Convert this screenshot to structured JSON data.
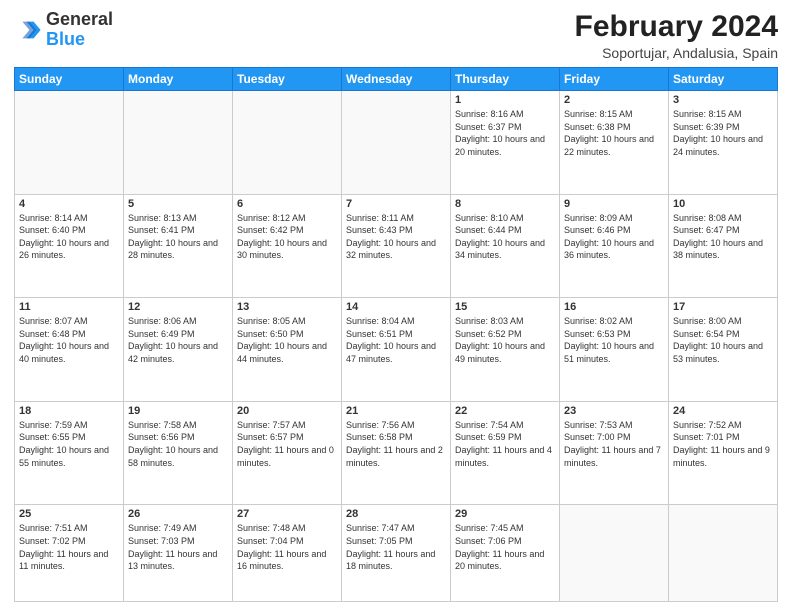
{
  "logo": {
    "line1": "General",
    "line2": "Blue"
  },
  "title": "February 2024",
  "subtitle": "Soportujar, Andalusia, Spain",
  "days_of_week": [
    "Sunday",
    "Monday",
    "Tuesday",
    "Wednesday",
    "Thursday",
    "Friday",
    "Saturday"
  ],
  "weeks": [
    [
      {
        "day": "",
        "info": ""
      },
      {
        "day": "",
        "info": ""
      },
      {
        "day": "",
        "info": ""
      },
      {
        "day": "",
        "info": ""
      },
      {
        "day": "1",
        "info": "Sunrise: 8:16 AM\nSunset: 6:37 PM\nDaylight: 10 hours and 20 minutes."
      },
      {
        "day": "2",
        "info": "Sunrise: 8:15 AM\nSunset: 6:38 PM\nDaylight: 10 hours and 22 minutes."
      },
      {
        "day": "3",
        "info": "Sunrise: 8:15 AM\nSunset: 6:39 PM\nDaylight: 10 hours and 24 minutes."
      }
    ],
    [
      {
        "day": "4",
        "info": "Sunrise: 8:14 AM\nSunset: 6:40 PM\nDaylight: 10 hours and 26 minutes."
      },
      {
        "day": "5",
        "info": "Sunrise: 8:13 AM\nSunset: 6:41 PM\nDaylight: 10 hours and 28 minutes."
      },
      {
        "day": "6",
        "info": "Sunrise: 8:12 AM\nSunset: 6:42 PM\nDaylight: 10 hours and 30 minutes."
      },
      {
        "day": "7",
        "info": "Sunrise: 8:11 AM\nSunset: 6:43 PM\nDaylight: 10 hours and 32 minutes."
      },
      {
        "day": "8",
        "info": "Sunrise: 8:10 AM\nSunset: 6:44 PM\nDaylight: 10 hours and 34 minutes."
      },
      {
        "day": "9",
        "info": "Sunrise: 8:09 AM\nSunset: 6:46 PM\nDaylight: 10 hours and 36 minutes."
      },
      {
        "day": "10",
        "info": "Sunrise: 8:08 AM\nSunset: 6:47 PM\nDaylight: 10 hours and 38 minutes."
      }
    ],
    [
      {
        "day": "11",
        "info": "Sunrise: 8:07 AM\nSunset: 6:48 PM\nDaylight: 10 hours and 40 minutes."
      },
      {
        "day": "12",
        "info": "Sunrise: 8:06 AM\nSunset: 6:49 PM\nDaylight: 10 hours and 42 minutes."
      },
      {
        "day": "13",
        "info": "Sunrise: 8:05 AM\nSunset: 6:50 PM\nDaylight: 10 hours and 44 minutes."
      },
      {
        "day": "14",
        "info": "Sunrise: 8:04 AM\nSunset: 6:51 PM\nDaylight: 10 hours and 47 minutes."
      },
      {
        "day": "15",
        "info": "Sunrise: 8:03 AM\nSunset: 6:52 PM\nDaylight: 10 hours and 49 minutes."
      },
      {
        "day": "16",
        "info": "Sunrise: 8:02 AM\nSunset: 6:53 PM\nDaylight: 10 hours and 51 minutes."
      },
      {
        "day": "17",
        "info": "Sunrise: 8:00 AM\nSunset: 6:54 PM\nDaylight: 10 hours and 53 minutes."
      }
    ],
    [
      {
        "day": "18",
        "info": "Sunrise: 7:59 AM\nSunset: 6:55 PM\nDaylight: 10 hours and 55 minutes."
      },
      {
        "day": "19",
        "info": "Sunrise: 7:58 AM\nSunset: 6:56 PM\nDaylight: 10 hours and 58 minutes."
      },
      {
        "day": "20",
        "info": "Sunrise: 7:57 AM\nSunset: 6:57 PM\nDaylight: 11 hours and 0 minutes."
      },
      {
        "day": "21",
        "info": "Sunrise: 7:56 AM\nSunset: 6:58 PM\nDaylight: 11 hours and 2 minutes."
      },
      {
        "day": "22",
        "info": "Sunrise: 7:54 AM\nSunset: 6:59 PM\nDaylight: 11 hours and 4 minutes."
      },
      {
        "day": "23",
        "info": "Sunrise: 7:53 AM\nSunset: 7:00 PM\nDaylight: 11 hours and 7 minutes."
      },
      {
        "day": "24",
        "info": "Sunrise: 7:52 AM\nSunset: 7:01 PM\nDaylight: 11 hours and 9 minutes."
      }
    ],
    [
      {
        "day": "25",
        "info": "Sunrise: 7:51 AM\nSunset: 7:02 PM\nDaylight: 11 hours and 11 minutes."
      },
      {
        "day": "26",
        "info": "Sunrise: 7:49 AM\nSunset: 7:03 PM\nDaylight: 11 hours and 13 minutes."
      },
      {
        "day": "27",
        "info": "Sunrise: 7:48 AM\nSunset: 7:04 PM\nDaylight: 11 hours and 16 minutes."
      },
      {
        "day": "28",
        "info": "Sunrise: 7:47 AM\nSunset: 7:05 PM\nDaylight: 11 hours and 18 minutes."
      },
      {
        "day": "29",
        "info": "Sunrise: 7:45 AM\nSunset: 7:06 PM\nDaylight: 11 hours and 20 minutes."
      },
      {
        "day": "",
        "info": ""
      },
      {
        "day": "",
        "info": ""
      }
    ]
  ]
}
